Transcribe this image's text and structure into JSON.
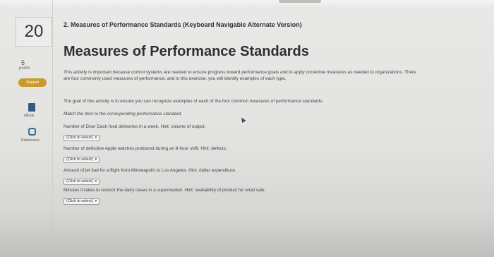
{
  "sidebar": {
    "question_number": "20",
    "points_value": "5",
    "points_label": "points",
    "status_badge": "Skipped",
    "ebook_label": "eBook",
    "references_label": "References"
  },
  "question": {
    "heading": "2. Measures of Performance Standards (Keyboard Navigable Alternate Version)",
    "title": "Measures of Performance Standards",
    "intro": "This activity is important because control systems are needed to ensure progress toward performance goals and to apply corrective measures as needed to organizations. There are four commonly used measures of performance, and in this exercise, you will identify examples of each type.",
    "goal": "The goal of this activity is to ensure you can recognize examples of each of the four common measures of performance standards.",
    "instruction": "Match the item to the corresponding performance standard."
  },
  "items": [
    {
      "text": "Number of Door Dash food deliveries in a week. Hint: volume of output.",
      "select": "(Click to select)"
    },
    {
      "text": "Number of defective Apple watches produced during an 8-hour shift. Hint: defects.",
      "select": "(Click to select)"
    },
    {
      "text": "Amount of jet fuel for a flight from Minneapolis to Los Angeles. Hint: dollar expenditure.",
      "select": "(Click to select)"
    },
    {
      "text": "Minutes it takes to restock the dairy cases in a supermarket. Hint: availability of product for retail sale.",
      "select": "(Click to select)"
    }
  ]
}
